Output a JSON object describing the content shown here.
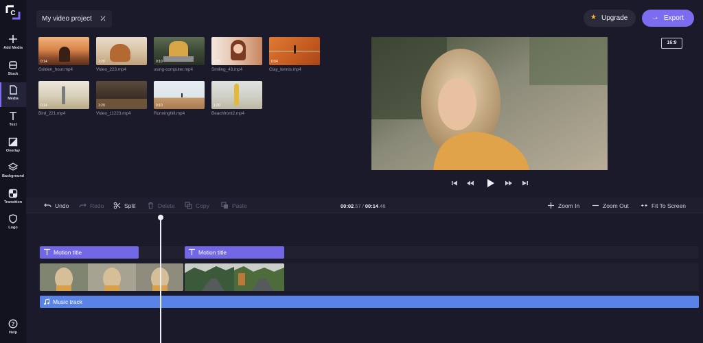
{
  "sidebar": {
    "items": [
      {
        "label": "Add Media",
        "icon": "plus-icon"
      },
      {
        "label": "Stock",
        "icon": "stock-icon"
      },
      {
        "label": "Media",
        "icon": "file-icon"
      },
      {
        "label": "Text",
        "icon": "text-icon"
      },
      {
        "label": "Overlay",
        "icon": "overlay-icon"
      },
      {
        "label": "Background",
        "icon": "layers-icon"
      },
      {
        "label": "Transition",
        "icon": "transition-icon"
      },
      {
        "label": "Logo",
        "icon": "shield-icon"
      }
    ],
    "help": {
      "label": "Help",
      "icon": "help-icon"
    }
  },
  "header": {
    "project_title": "My video project",
    "upgrade_label": "Upgrade",
    "export_label": "Export"
  },
  "media": [
    {
      "name": "Golden_hour.mp4",
      "duration": "0:14"
    },
    {
      "name": "Video_223.mp4",
      "duration": "1:20"
    },
    {
      "name": "using-computer.mp4",
      "duration": "0:10"
    },
    {
      "name": "Smiling_43.mp4",
      "duration": "1:20"
    },
    {
      "name": "Clay_tennis.mp4",
      "duration": "0:04"
    },
    {
      "name": "Bird_221.mp4",
      "duration": "0:14"
    },
    {
      "name": "Video_11223.mp4",
      "duration": "1:20"
    },
    {
      "name": "Runninghill.mp4",
      "duration": "0:10"
    },
    {
      "name": "Beachfront2.mp4",
      "duration": "1:20"
    }
  ],
  "preview": {
    "aspect_ratio": "16:9"
  },
  "toolbar": {
    "undo": "Undo",
    "redo": "Redo",
    "split": "Split",
    "delete": "Delete",
    "copy": "Copy",
    "paste": "Paste",
    "time_current": "00:02",
    "time_current_frac": ".57",
    "time_sep": " / ",
    "time_total": "00:14",
    "time_total_frac": ".48",
    "zoom_in": "Zoom In",
    "zoom_out": "Zoom Out",
    "fit": "Fit To Screen"
  },
  "timeline": {
    "title_clip_1": "Motion title",
    "title_clip_2": "Motion title",
    "music_track": "Music track"
  },
  "colors": {
    "accent": "#7b6cf0",
    "title_clip": "#7268e6",
    "music_clip": "#5a83e8",
    "background": "#1a1a2a"
  }
}
